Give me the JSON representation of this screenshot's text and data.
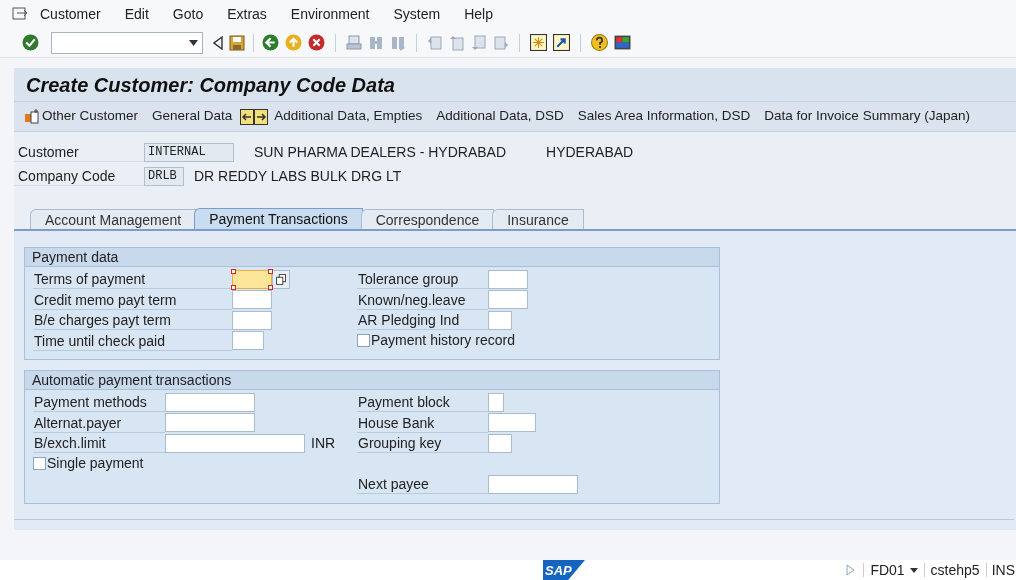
{
  "menu": [
    {
      "label": "Customer"
    },
    {
      "label": "Edit"
    },
    {
      "label": "Goto"
    },
    {
      "label": "Extras"
    },
    {
      "label": "Environment"
    },
    {
      "label": "System"
    },
    {
      "label": "Help"
    }
  ],
  "title": "Create Customer: Company Code Data",
  "app_toolbar": [
    {
      "label": "Other Customer"
    },
    {
      "label": "General Data"
    },
    {
      "label": "Additional Data, Empties"
    },
    {
      "label": "Additional Data, DSD"
    },
    {
      "label": "Sales Area Information, DSD"
    },
    {
      "label": "Data for Invoice Summary (Japan)"
    }
  ],
  "header": [
    {
      "label": "Customer",
      "value": "INTERNAL",
      "texts": [
        "SUN PHARMA DEALERS - HYDRABAD",
        "HYDERABAD"
      ]
    },
    {
      "label": "Company Code",
      "value": "DRLB",
      "texts": [
        "DR REDDY LABS BULK DRG LT"
      ]
    }
  ],
  "tabs": [
    {
      "label": "Account Management",
      "selected": false
    },
    {
      "label": "Payment Transactions",
      "selected": true
    },
    {
      "label": "Correspondence",
      "selected": false
    },
    {
      "label": "Insurance",
      "selected": false
    }
  ],
  "groups": [
    {
      "title": "Payment data",
      "rows": [
        {
          "left": {
            "kind": "input",
            "label": "Terms of payment",
            "focused": true
          },
          "right": {
            "kind": "input",
            "label": "Tolerance group",
            "focused": false
          }
        },
        {
          "left": {
            "kind": "input",
            "label": "Credit memo payt term",
            "focused": false
          },
          "right": {
            "kind": "input",
            "label": "Known/neg.leave",
            "focused": false
          }
        },
        {
          "left": {
            "kind": "input",
            "label": "B/e charges payt term",
            "focused": false
          },
          "right": {
            "kind": "input",
            "label": "AR Pledging Ind",
            "focused": false
          }
        },
        {
          "left": {
            "kind": "input",
            "label": "Time until check paid",
            "focused": false
          },
          "right": {
            "kind": "checkbox",
            "label": "Payment history record",
            "checked": false
          }
        }
      ]
    },
    {
      "title": "Automatic payment transactions",
      "rows": [
        {
          "left": {
            "kind": "input",
            "label": "Payment methods",
            "focused": false
          },
          "right": {
            "kind": "input",
            "label": "Payment block",
            "focused": false
          }
        },
        {
          "left": {
            "kind": "input",
            "label": "Alternat.payer",
            "focused": false
          },
          "right": {
            "kind": "input",
            "label": "House Bank",
            "focused": false
          }
        },
        {
          "left": {
            "kind": "input",
            "label": "B/exch.limit",
            "focused": false,
            "unit": "INR"
          },
          "right": {
            "kind": "input",
            "label": "Grouping key",
            "focused": false
          }
        },
        {
          "left": {
            "kind": "checkbox",
            "label": "Single payment",
            "checked": false
          }
        },
        {
          "right": {
            "kind": "input",
            "label": "Next payee",
            "focused": false
          }
        }
      ]
    }
  ],
  "logo": "SAP",
  "status_bar": {
    "transaction": "FD01",
    "server": "cstehp5",
    "mode": "INS"
  }
}
